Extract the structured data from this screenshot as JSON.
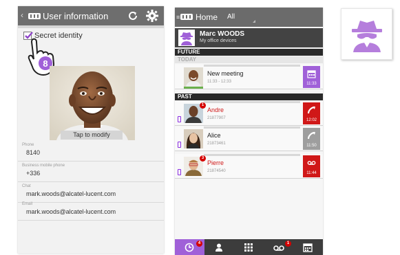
{
  "left_screen": {
    "title": "User information",
    "secret_identity_label": "Secret identity",
    "step_number": "8",
    "tap_to_modify": "Tap to modify",
    "fields": [
      {
        "label": "Phone",
        "value": "8140"
      },
      {
        "label": "Business mobile phone",
        "value": "+336"
      },
      {
        "label": "Chat",
        "value": "mark.woods@alcatel-lucent.com"
      },
      {
        "label": "Email",
        "value": "mark.woods@alcatel-lucent.com"
      }
    ]
  },
  "right_screen": {
    "header": {
      "home": "Home",
      "filter": "All"
    },
    "profile": {
      "name": "Marc WOODS",
      "subtitle": "My office devices"
    },
    "sections": {
      "future": "FUTURE",
      "today": "TODAY",
      "past": "PAST"
    },
    "items": [
      {
        "name": "New meeting",
        "detail": "11:33 - 12:33",
        "time": "11:33",
        "color": "#a060d8",
        "icon": "calendar-icon",
        "badge": ""
      },
      {
        "name": "Andre",
        "detail": "21877907",
        "time": "12:02",
        "color": "#d01818",
        "icon": "missed-call-icon",
        "badge": "1"
      },
      {
        "name": "Alice",
        "detail": "21873461",
        "time": "11:50",
        "color": "#9e9e9e",
        "icon": "outgoing-call-icon",
        "badge": ""
      },
      {
        "name": "Pierre",
        "detail": "21874540",
        "time": "11:44",
        "color": "#d01818",
        "icon": "voicemail-icon",
        "badge": "3"
      }
    ],
    "tabs": [
      {
        "name": "history-icon",
        "badge": "4"
      },
      {
        "name": "contacts-icon",
        "badge": ""
      },
      {
        "name": "dialpad-icon",
        "badge": ""
      },
      {
        "name": "voicemail-icon",
        "badge": "1"
      },
      {
        "name": "calendar-icon",
        "badge": ""
      }
    ]
  },
  "colors": {
    "accent": "#a060d8",
    "missed": "#d01818",
    "header": "#6b6b6b"
  }
}
